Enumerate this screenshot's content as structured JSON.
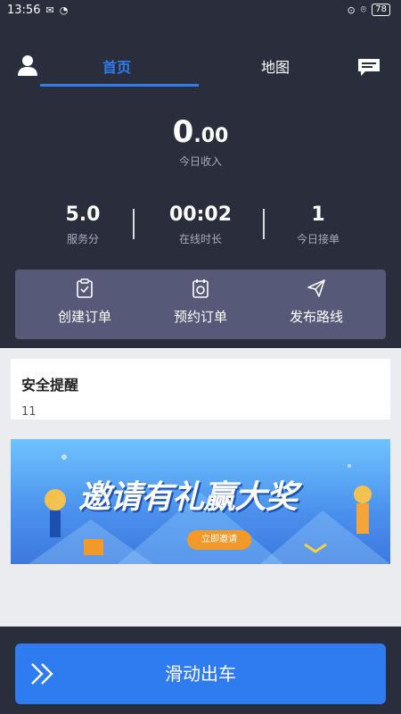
{
  "status_bar": {
    "time": "13:56",
    "battery": "78"
  },
  "nav": {
    "tabs": [
      {
        "label": "首页"
      },
      {
        "label": "地图"
      }
    ]
  },
  "earnings": {
    "amount_int": "0",
    "amount_dec": ".00",
    "label": "今日收入"
  },
  "stats": [
    {
      "value": "5.0",
      "label": "服务分"
    },
    {
      "value": "00:02",
      "label": "在线时长"
    },
    {
      "value": "1",
      "label": "今日接单"
    }
  ],
  "actions": [
    {
      "label": "创建订单",
      "icon": "clipboard-icon"
    },
    {
      "label": "预约订单",
      "icon": "calendar-icon"
    },
    {
      "label": "发布路线",
      "icon": "send-icon"
    }
  ],
  "notice": {
    "title": "安全提醒",
    "count": "11"
  },
  "banner": {
    "headline": "邀请有礼赢大奖",
    "button": "立即邀请"
  },
  "bottom": {
    "button_label": "滑动出车"
  },
  "colors": {
    "accent": "#2f7bf0",
    "background": "#2a2d3c",
    "action_panel": "#565a78"
  }
}
